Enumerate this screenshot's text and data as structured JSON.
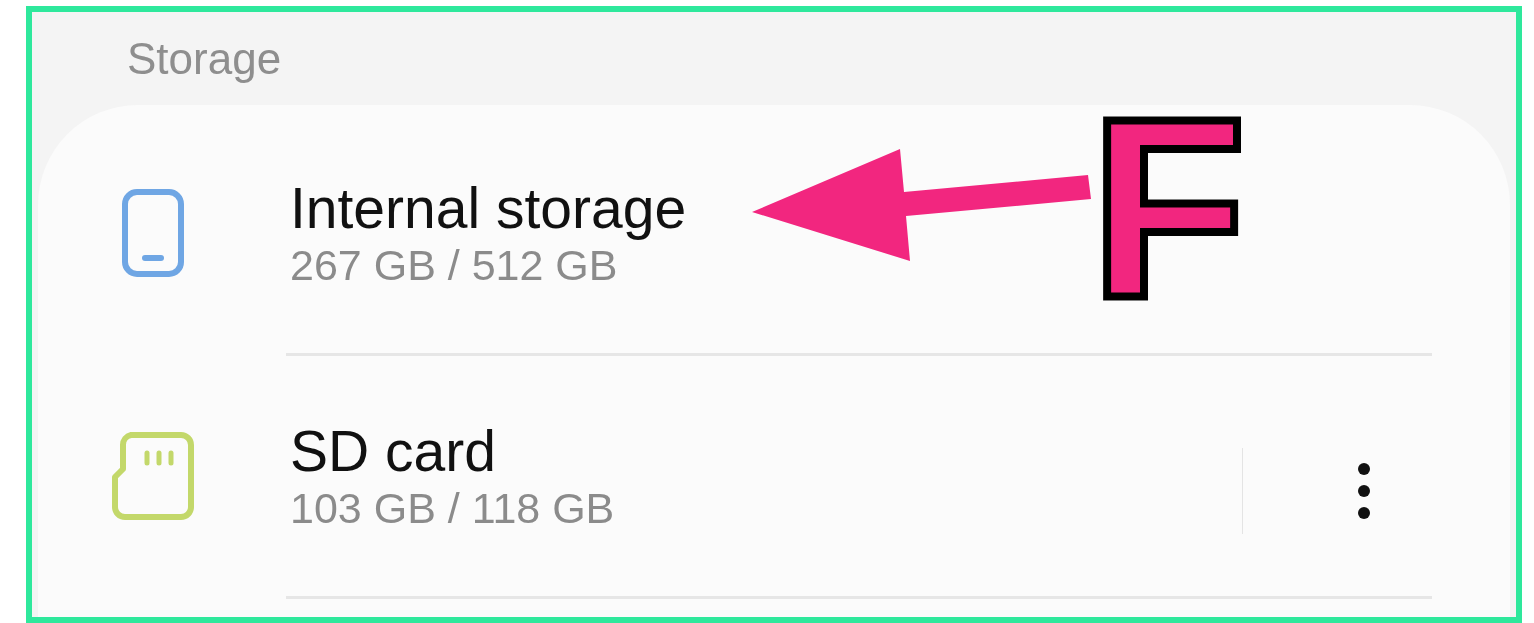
{
  "section_title": "Storage",
  "items": [
    {
      "kind": "internal",
      "title": "Internal storage",
      "usage": "267 GB / 512 GB",
      "menu": false
    },
    {
      "kind": "sd",
      "title": "SD card",
      "usage": "103 GB / 118 GB",
      "menu": true
    }
  ],
  "annotation": {
    "letter": "F"
  }
}
